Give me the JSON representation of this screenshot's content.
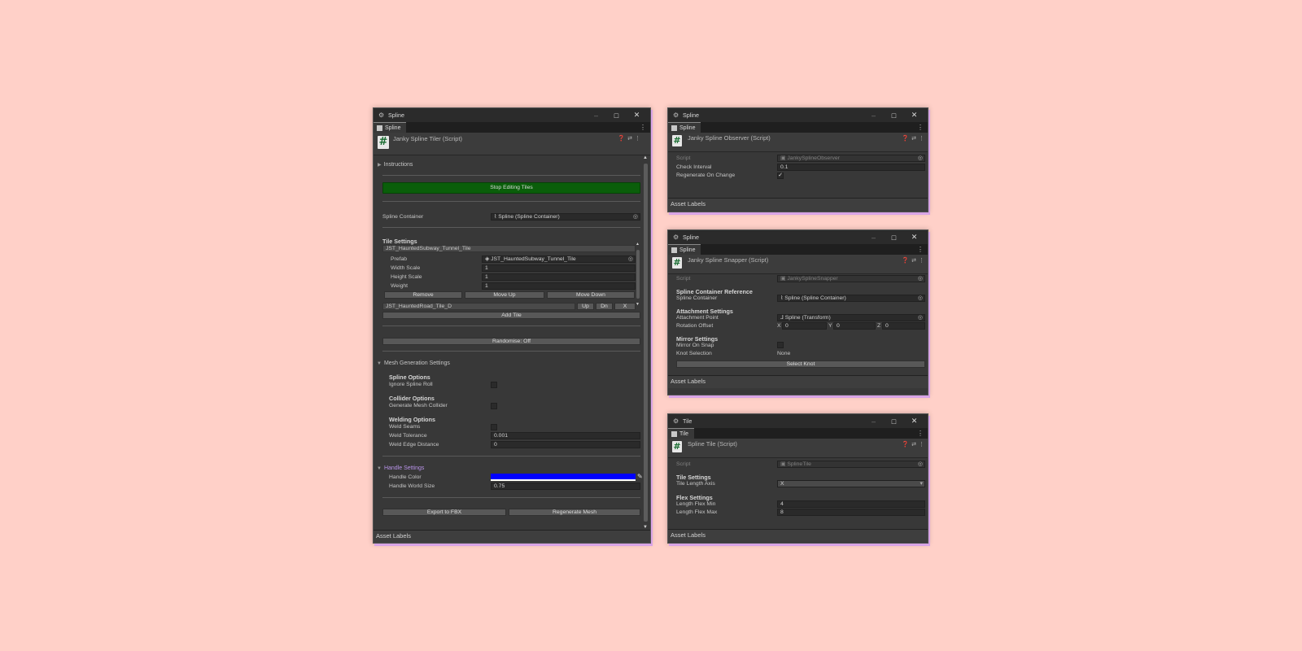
{
  "win_tiler": {
    "title": "Spline",
    "tab": "Spline",
    "header": "Janky Spline Tiler (Script)",
    "instructions": "Instructions",
    "stop_editing": "Stop Editing Tiles",
    "spline_container_label": "Spline Container",
    "spline_container_value": "Spline (Spline Container)",
    "tile_settings": "Tile Settings",
    "tile1_name": "JST_HauntedSubway_Tunnel_Tile",
    "prefab_label": "Prefab",
    "prefab_value": "JST_HauntedSubway_Tunnel_Tile",
    "width_scale_label": "Width Scale",
    "width_scale_value": "1",
    "height_scale_label": "Height Scale",
    "height_scale_value": "1",
    "weight_label": "Weight",
    "weight_value": "1",
    "remove": "Remove",
    "move_up": "Move Up",
    "move_down": "Move Down",
    "tile2_name": "JST_HauntedRoad_Tile_D",
    "up": "Up",
    "dn": "Dn",
    "x": "X",
    "add_tile": "Add Tile",
    "randomise": "Randomise: Off",
    "mesh_gen": "Mesh Generation Settings",
    "spline_options": "Spline Options",
    "ignore_roll": "Ignore Spline Roll",
    "collider_options": "Collider Options",
    "gen_mesh_collider": "Generate Mesh Collider",
    "welding_options": "Welding Options",
    "weld_seams": "Weld Seams",
    "weld_tolerance_label": "Weld Tolerance",
    "weld_tolerance_value": "0.001",
    "weld_edge_label": "Weld Edge Distance",
    "weld_edge_value": "0",
    "handle_settings": "Handle Settings",
    "handle_color_label": "Handle Color",
    "handle_color": "#0000ff",
    "handle_size_label": "Handle World Size",
    "handle_size_value": "0.75",
    "export_fbx": "Export to FBX",
    "regen_mesh": "Regenerate Mesh",
    "asset_labels": "Asset Labels"
  },
  "win_observer": {
    "title": "Spline",
    "tab": "Spline",
    "header": "Janky Spline Observer (Script)",
    "script_label": "Script",
    "script_value": "JankySplineObserver",
    "check_interval_label": "Check Interval",
    "check_interval_value": "0.1",
    "regen_label": "Regenerate On Change",
    "regen_checked": "✓",
    "asset_labels": "Asset Labels"
  },
  "win_snapper": {
    "title": "Spline",
    "tab": "Spline",
    "header": "Janky Spline Snapper (Script)",
    "script_label": "Script",
    "script_value": "JankySplineSnapper",
    "scr_heading": "Spline Container Reference",
    "sc_label": "Spline Container",
    "sc_value": "Spline (Spline Container)",
    "attach_heading": "Attachment Settings",
    "attach_point_label": "Attachment Point",
    "attach_point_value": "Spline (Transform)",
    "rot_offset_label": "Rotation Offset",
    "rot_x_label": "X",
    "rot_x": "0",
    "rot_y_label": "Y",
    "rot_y": "0",
    "rot_z_label": "Z",
    "rot_z": "0",
    "mirror_heading": "Mirror Settings",
    "mirror_snap_label": "Mirror On Snap",
    "knot_sel_label": "Knot Selection",
    "knot_sel_value": "None",
    "select_knot": "Select Knot",
    "asset_labels": "Asset Labels"
  },
  "win_tile": {
    "title": "Tile",
    "tab": "Tile",
    "header": "Spline Tile (Script)",
    "script_label": "Script",
    "script_value": "SplineTile",
    "tile_heading": "Tile Settings",
    "axis_label": "Tile Length Axis",
    "axis_value": "X",
    "flex_heading": "Flex Settings",
    "flex_min_label": "Length Flex Min",
    "flex_min_value": "4",
    "flex_max_label": "Length Flex Max",
    "flex_max_value": "8",
    "asset_labels": "Asset Labels"
  },
  "icons": [
    "unity-icon",
    "maximize-icon",
    "close-icon",
    "kebab-icon",
    "script-hash-icon",
    "help-icon",
    "settings-icon",
    "object-picker-icon",
    "eyedropper-icon",
    "checkmark-icon",
    "dropdown-arrow-icon",
    "foldout-arrow-icon"
  ]
}
